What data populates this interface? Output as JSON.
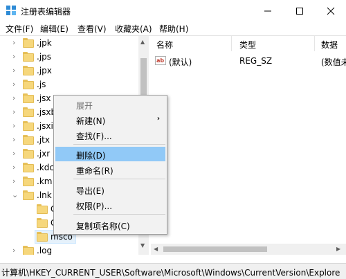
{
  "window": {
    "title": "注册表编辑器"
  },
  "menubar": {
    "items": [
      "文件(F)",
      "编辑(E)",
      "查看(V)",
      "收藏夹(A)",
      "帮助(H)"
    ]
  },
  "tree": {
    "items": [
      {
        "label": ".jpk",
        "expanded": false
      },
      {
        "label": ".jps",
        "expanded": false
      },
      {
        "label": ".jpx",
        "expanded": false
      },
      {
        "label": ".js",
        "expanded": false
      },
      {
        "label": ".jsx",
        "expanded": false
      },
      {
        "label": ".jsxb",
        "expanded": false
      },
      {
        "label": ".jsxi",
        "expanded": false
      },
      {
        "label": ".jtx",
        "expanded": false
      },
      {
        "label": ".jxr",
        "expanded": false
      },
      {
        "label": ".kdc",
        "expanded": false
      },
      {
        "label": ".km",
        "expanded": false
      },
      {
        "label": ".lnk",
        "expanded": true
      }
    ],
    "children": [
      "C",
      "C",
      "msco"
    ],
    "after": ".log"
  },
  "list": {
    "columns": [
      "名称",
      "类型",
      "数据"
    ],
    "rows": [
      {
        "name": "(默认)",
        "type": "REG_SZ",
        "data": "(数值未"
      }
    ]
  },
  "context_menu": {
    "items": [
      {
        "label": "展开",
        "disabled": true
      },
      {
        "label": "新建(N)",
        "submenu": true
      },
      {
        "label": "查找(F)..."
      },
      {
        "label": "删除(D)",
        "highlight": true
      },
      {
        "label": "重命名(R)"
      },
      {
        "label": "导出(E)"
      },
      {
        "label": "权限(P)..."
      },
      {
        "label": "复制项名称(C)"
      }
    ]
  },
  "statusbar": {
    "path": "计算机\\HKEY_CURRENT_USER\\Software\\Microsoft\\Windows\\CurrentVersion\\Explore"
  },
  "colors": {
    "highlight": "#91c9f7",
    "folder": "#f6d77c",
    "menu_bg": "#f2f2f2"
  }
}
